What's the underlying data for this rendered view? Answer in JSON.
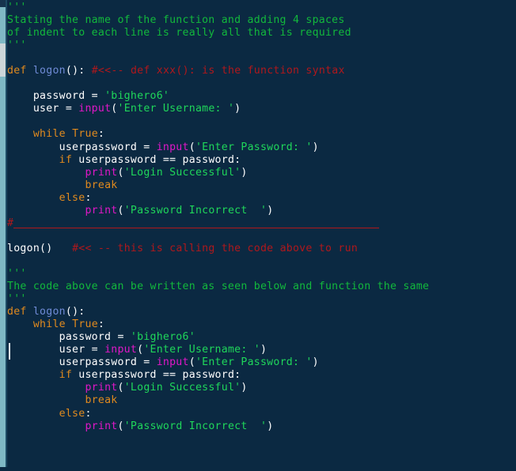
{
  "theme": {
    "background": "#0b2942",
    "foreground": "#ffffff",
    "keyword_color": "#e08a1e",
    "function_color": "#6f8bd6",
    "builtin_color": "#e018c8",
    "string_color": "#1fd65a",
    "docstring_color": "#12b83c",
    "comment_color": "#b0181c",
    "gutter_color": "#7fb8c4",
    "scrollbar_thumb_color": "#cdd6d9",
    "caret_color": "#f2f7fa"
  },
  "editor": {
    "name": "python-code-editor",
    "language": "Python",
    "caret_line": 27,
    "caret_column": 0
  },
  "code": {
    "lines": [
      {
        "n": 1,
        "tokens": [
          {
            "t": "'''",
            "c": "doc"
          }
        ]
      },
      {
        "n": 2,
        "tokens": [
          {
            "t": "Stating the name of the function and adding 4 spaces",
            "c": "doc"
          }
        ]
      },
      {
        "n": 3,
        "tokens": [
          {
            "t": "of indent to each line is really all that is required",
            "c": "doc"
          }
        ]
      },
      {
        "n": 4,
        "tokens": [
          {
            "t": "'''",
            "c": "doc"
          }
        ]
      },
      {
        "n": 5,
        "tokens": []
      },
      {
        "n": 6,
        "tokens": [
          {
            "t": "def",
            "c": "kw"
          },
          {
            "t": " ",
            "c": "pun"
          },
          {
            "t": "logon",
            "c": "fn"
          },
          {
            "t": "():",
            "c": "pun"
          },
          {
            "t": " ",
            "c": "pun"
          },
          {
            "t": "#<<-- def xxx(): is the function syntax",
            "c": "com"
          }
        ]
      },
      {
        "n": 7,
        "tokens": []
      },
      {
        "n": 8,
        "tokens": [
          {
            "t": "    password = ",
            "c": "pun"
          },
          {
            "t": "'bighero6'",
            "c": "str"
          }
        ]
      },
      {
        "n": 9,
        "tokens": [
          {
            "t": "    user = ",
            "c": "pun"
          },
          {
            "t": "input",
            "c": "builtin"
          },
          {
            "t": "(",
            "c": "pun"
          },
          {
            "t": "'Enter Username: '",
            "c": "str"
          },
          {
            "t": ")",
            "c": "pun"
          }
        ]
      },
      {
        "n": 10,
        "tokens": []
      },
      {
        "n": 11,
        "tokens": [
          {
            "t": "    ",
            "c": "pun"
          },
          {
            "t": "while",
            "c": "kw"
          },
          {
            "t": " ",
            "c": "pun"
          },
          {
            "t": "True",
            "c": "kw"
          },
          {
            "t": ":",
            "c": "pun"
          }
        ]
      },
      {
        "n": 12,
        "tokens": [
          {
            "t": "        userpassword = ",
            "c": "pun"
          },
          {
            "t": "input",
            "c": "builtin"
          },
          {
            "t": "(",
            "c": "pun"
          },
          {
            "t": "'Enter Password: '",
            "c": "str"
          },
          {
            "t": ")",
            "c": "pun"
          }
        ]
      },
      {
        "n": 13,
        "tokens": [
          {
            "t": "        ",
            "c": "pun"
          },
          {
            "t": "if",
            "c": "kw"
          },
          {
            "t": " userpassword == password:",
            "c": "pun"
          }
        ]
      },
      {
        "n": 14,
        "tokens": [
          {
            "t": "            ",
            "c": "pun"
          },
          {
            "t": "print",
            "c": "builtin"
          },
          {
            "t": "(",
            "c": "pun"
          },
          {
            "t": "'Login Successful'",
            "c": "str"
          },
          {
            "t": ")",
            "c": "pun"
          }
        ]
      },
      {
        "n": 15,
        "tokens": [
          {
            "t": "            ",
            "c": "pun"
          },
          {
            "t": "break",
            "c": "kw"
          }
        ]
      },
      {
        "n": 16,
        "tokens": [
          {
            "t": "        ",
            "c": "pun"
          },
          {
            "t": "else",
            "c": "kw"
          },
          {
            "t": ":",
            "c": "pun"
          }
        ]
      },
      {
        "n": 17,
        "tokens": [
          {
            "t": "            ",
            "c": "pun"
          },
          {
            "t": "print",
            "c": "builtin"
          },
          {
            "t": "(",
            "c": "pun"
          },
          {
            "t": "'Password Incorrect  '",
            "c": "str"
          },
          {
            "t": ")",
            "c": "pun"
          }
        ]
      },
      {
        "n": 18,
        "tokens": [
          {
            "t": "#",
            "c": "com"
          }
        ]
      },
      {
        "n": 19,
        "tokens": []
      },
      {
        "n": 20,
        "tokens": [
          {
            "t": "logon()",
            "c": "pun"
          },
          {
            "t": "   ",
            "c": "pun"
          },
          {
            "t": "#<< -- this is calling the code above to run",
            "c": "com"
          }
        ]
      },
      {
        "n": 21,
        "tokens": []
      },
      {
        "n": 22,
        "tokens": [
          {
            "t": "'''",
            "c": "doc"
          }
        ]
      },
      {
        "n": 23,
        "tokens": [
          {
            "t": "The code above can be written as seen below and function the same",
            "c": "doc"
          }
        ]
      },
      {
        "n": 24,
        "tokens": [
          {
            "t": "'''",
            "c": "doc"
          }
        ]
      },
      {
        "n": 25,
        "tokens": [
          {
            "t": "def",
            "c": "kw"
          },
          {
            "t": " ",
            "c": "pun"
          },
          {
            "t": "logon",
            "c": "fn"
          },
          {
            "t": "():",
            "c": "pun"
          }
        ]
      },
      {
        "n": 26,
        "tokens": [
          {
            "t": "    ",
            "c": "pun"
          },
          {
            "t": "while",
            "c": "kw"
          },
          {
            "t": " ",
            "c": "pun"
          },
          {
            "t": "True",
            "c": "kw"
          },
          {
            "t": ":",
            "c": "pun"
          }
        ]
      },
      {
        "n": 27,
        "tokens": [
          {
            "t": "        password = ",
            "c": "pun"
          },
          {
            "t": "'bighero6'",
            "c": "str"
          }
        ]
      },
      {
        "n": 28,
        "tokens": [
          {
            "t": "        user = ",
            "c": "pun"
          },
          {
            "t": "input",
            "c": "builtin"
          },
          {
            "t": "(",
            "c": "pun"
          },
          {
            "t": "'Enter Username: '",
            "c": "str"
          },
          {
            "t": ")",
            "c": "pun"
          }
        ]
      },
      {
        "n": 29,
        "tokens": [
          {
            "t": "        userpassword = ",
            "c": "pun"
          },
          {
            "t": "input",
            "c": "builtin"
          },
          {
            "t": "(",
            "c": "pun"
          },
          {
            "t": "'Enter Password: '",
            "c": "str"
          },
          {
            "t": ")",
            "c": "pun"
          }
        ]
      },
      {
        "n": 30,
        "tokens": [
          {
            "t": "        ",
            "c": "pun"
          },
          {
            "t": "if",
            "c": "kw"
          },
          {
            "t": " userpassword == password:",
            "c": "pun"
          }
        ]
      },
      {
        "n": 31,
        "tokens": [
          {
            "t": "            ",
            "c": "pun"
          },
          {
            "t": "print",
            "c": "builtin"
          },
          {
            "t": "(",
            "c": "pun"
          },
          {
            "t": "'Login Successful'",
            "c": "str"
          },
          {
            "t": ")",
            "c": "pun"
          }
        ]
      },
      {
        "n": 32,
        "tokens": [
          {
            "t": "            ",
            "c": "pun"
          },
          {
            "t": "break",
            "c": "kw"
          }
        ]
      },
      {
        "n": 33,
        "tokens": [
          {
            "t": "        ",
            "c": "pun"
          },
          {
            "t": "else",
            "c": "kw"
          },
          {
            "t": ":",
            "c": "pun"
          }
        ]
      },
      {
        "n": 34,
        "tokens": [
          {
            "t": "            ",
            "c": "pun"
          },
          {
            "t": "print",
            "c": "builtin"
          },
          {
            "t": "(",
            "c": "pun"
          },
          {
            "t": "'Password Incorrect  '",
            "c": "str"
          },
          {
            "t": ")",
            "c": "pun"
          }
        ]
      },
      {
        "n": 35,
        "tokens": []
      },
      {
        "n": 36,
        "tokens": []
      },
      {
        "n": 37,
        "tokens": []
      }
    ]
  }
}
